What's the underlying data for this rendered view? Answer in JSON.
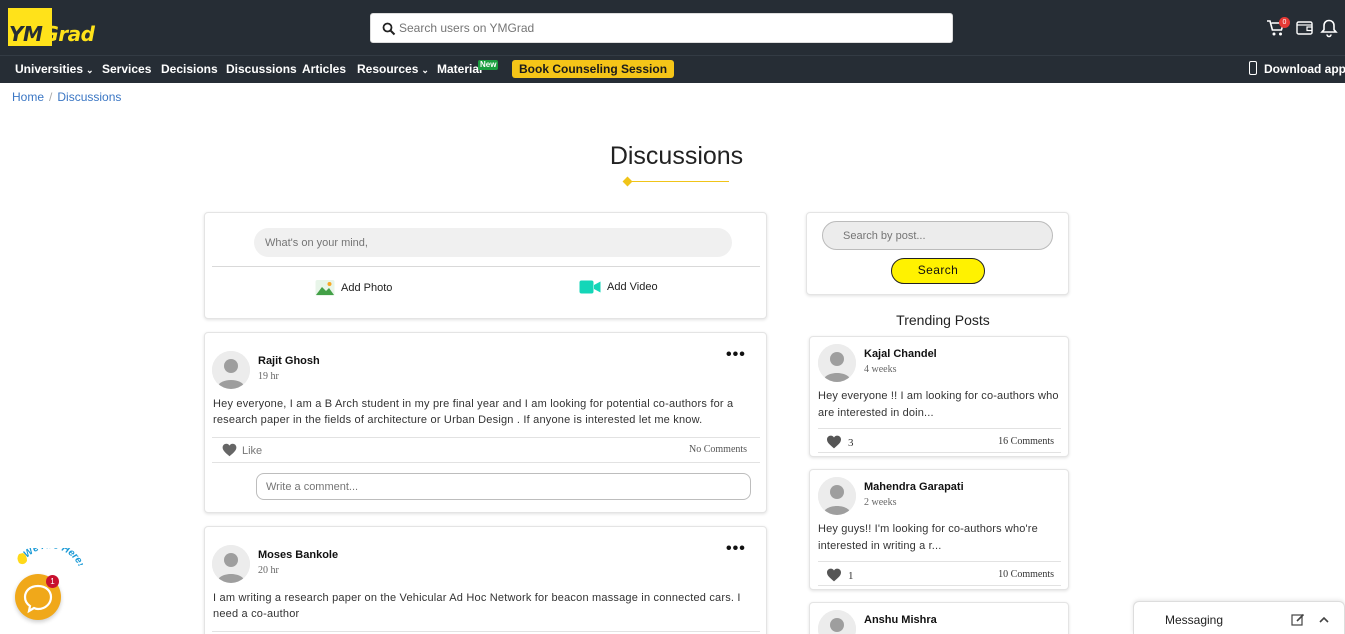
{
  "header": {
    "logo_part1": "YM",
    "logo_part2": "Grad",
    "search_placeholder": "Search users on YMGrad",
    "cart_count": "0",
    "icons": [
      "search-icon",
      "cart-icon",
      "wallet-icon",
      "bell-icon"
    ]
  },
  "nav": {
    "items": [
      {
        "label": "Universities",
        "dropdown": true
      },
      {
        "label": "Services",
        "dropdown": false
      },
      {
        "label": "Decisions",
        "dropdown": false
      },
      {
        "label": "Discussions",
        "dropdown": false
      },
      {
        "label": "Articles",
        "dropdown": false
      },
      {
        "label": "Resources",
        "dropdown": true
      },
      {
        "label": "Material",
        "dropdown": false
      }
    ],
    "new_badge": "New",
    "book_button": "Book Counseling Session",
    "download_app": "Download app"
  },
  "breadcrumb": {
    "home": "Home",
    "separator": "/",
    "current": "Discussions"
  },
  "page": {
    "title": "Discussions"
  },
  "composer": {
    "placeholder": "What's on your mind,",
    "add_photo": "Add Photo",
    "add_video": "Add Video"
  },
  "posts": [
    {
      "author": "Rajit Ghosh",
      "time": "19 hr",
      "body": "Hey everyone, I am a B Arch student in my pre final year and I am looking for potential co-authors for a research paper in the fields of architecture or Urban Design . If anyone is interested let me know.",
      "like_label": "Like",
      "comments": "No Comments",
      "comment_placeholder": "Write a comment..."
    },
    {
      "author": "Moses Bankole",
      "time": "20 hr",
      "body": "I am writing a research paper on the Vehicular Ad Hoc Network for beacon massage in connected cars. I need a co-author"
    }
  ],
  "sidebar": {
    "search_placeholder": "Search by post...",
    "search_button": "Search",
    "trending_title": "Trending Posts",
    "trending": [
      {
        "author": "Kajal Chandel",
        "time": "4 weeks",
        "body": "Hey everyone !! I am looking for co-authors who are interested in doin...",
        "likes": "3",
        "comments": "16 Comments"
      },
      {
        "author": "Mahendra Garapati",
        "time": "2 weeks",
        "body": "Hey guys!! I'm looking for co-authors who're interested in writing a r...",
        "likes": "1",
        "comments": "10 Comments"
      },
      {
        "author": "Anshu Mishra"
      }
    ]
  },
  "chat_widget": {
    "badge": "1",
    "tagline": "We Are Here!"
  },
  "messaging": {
    "label": "Messaging"
  },
  "colors": {
    "header_bg": "#262d35",
    "brand_yellow": "#ffe21a",
    "book_button": "#f5c518",
    "link_blue": "#3a76c4",
    "search_button": "#fff200",
    "new_badge": "#1a9e3f",
    "chat_orange": "#f0a81a"
  }
}
